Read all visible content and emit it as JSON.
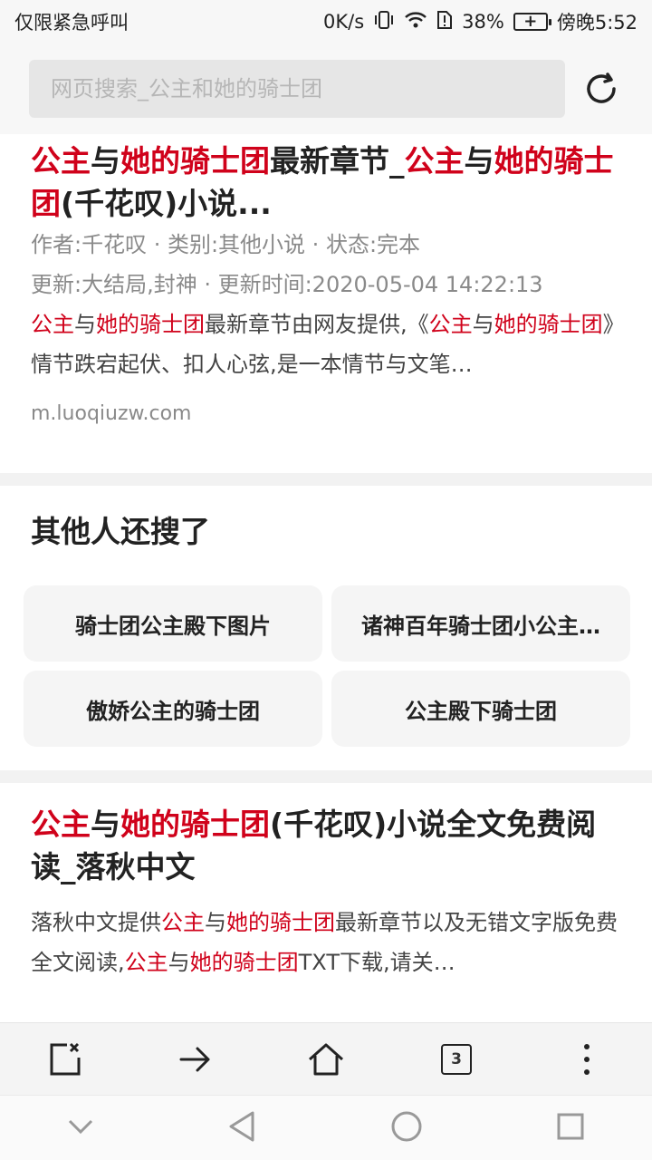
{
  "status_bar": {
    "carrier": "仅限紧急呼叫",
    "speed": "0K/s",
    "battery": "38%",
    "time": "傍晚5:52"
  },
  "search": {
    "placeholder": "网页搜索_公主和她的骑士团"
  },
  "results": [
    {
      "title_parts": [
        {
          "text": "公主",
          "hl": true
        },
        {
          "text": "与",
          "hl": false
        },
        {
          "text": "她的骑士团",
          "hl": true
        },
        {
          "text": "最新章节_",
          "hl": false
        },
        {
          "text": "公主",
          "hl": true
        },
        {
          "text": "与",
          "hl": false
        },
        {
          "text": "她的骑士团",
          "hl": true
        },
        {
          "text": "(千花叹)小说...",
          "hl": false
        }
      ],
      "meta_line1": "作者:千花叹 · 类别:其他小说 · 状态:完本",
      "meta_line2": "更新:大结局,封神 · 更新时间:2020-05-04 14:22:13",
      "snippet_parts": [
        {
          "text": "公主",
          "hl": true
        },
        {
          "text": "与",
          "hl": false
        },
        {
          "text": "她的骑士团",
          "hl": true
        },
        {
          "text": "最新章节由网友提供,《",
          "hl": false
        },
        {
          "text": "公主",
          "hl": true
        },
        {
          "text": "与",
          "hl": false
        },
        {
          "text": "她的骑士团",
          "hl": true
        },
        {
          "text": "》情节跌宕起伏、扣人心弦,是一本情节与文笔…",
          "hl": false
        }
      ],
      "url": "m.luoqiuzw.com"
    },
    {
      "title_parts": [
        {
          "text": "公主",
          "hl": true
        },
        {
          "text": "与",
          "hl": false
        },
        {
          "text": "她的骑士团",
          "hl": true
        },
        {
          "text": "(千花叹)小说全文免费阅读_落秋中文",
          "hl": false
        }
      ],
      "snippet_parts": [
        {
          "text": "落秋中文提供",
          "hl": false
        },
        {
          "text": "公主",
          "hl": true
        },
        {
          "text": "与",
          "hl": false
        },
        {
          "text": "她的骑士团",
          "hl": true
        },
        {
          "text": "最新章节以及无错文字版免费全文阅读,",
          "hl": false
        },
        {
          "text": "公主",
          "hl": true
        },
        {
          "text": "与",
          "hl": false
        },
        {
          "text": "她的骑士团",
          "hl": true
        },
        {
          "text": "TXT下载,请关…",
          "hl": false
        }
      ]
    }
  ],
  "related": {
    "title": "其他人还搜了",
    "items": [
      "骑士团公主殿下图片",
      "诸神百年骑士团小公主…",
      "傲娇公主的骑士团",
      "公主殿下骑士团"
    ]
  },
  "toolbar": {
    "tab_count": "3"
  }
}
